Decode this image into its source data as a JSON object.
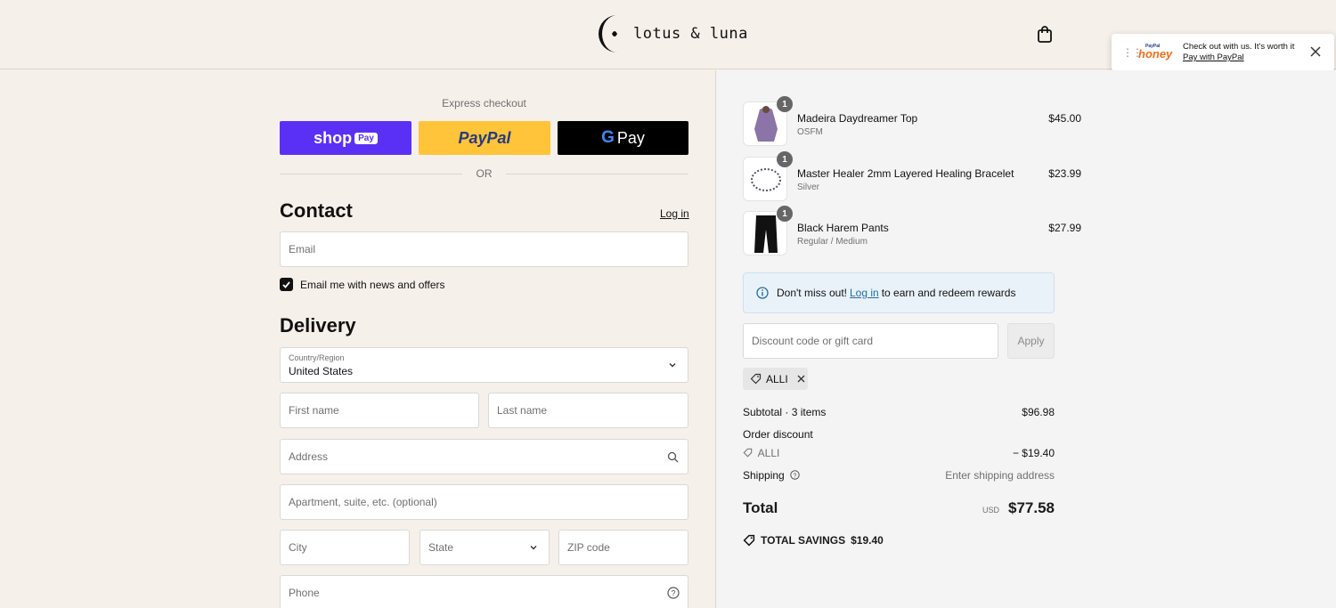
{
  "header": {
    "brand": "lotus & luna"
  },
  "honey": {
    "brand_small": "PayPal",
    "brand": "honey",
    "message": "Check out with us. It's worth it",
    "link": "Pay with PayPal"
  },
  "checkout": {
    "express_label": "Express checkout",
    "shop_pay": "shop",
    "shop_pay_badge": "Pay",
    "paypal": "PayPal",
    "gpay": "Pay",
    "or": "OR",
    "contact_title": "Contact",
    "login": "Log in",
    "email_placeholder": "Email",
    "email_opt_in": "Email me with news and offers",
    "delivery_title": "Delivery",
    "country_label": "Country/Region",
    "country_value": "United States",
    "first_name": "First name",
    "last_name": "Last name",
    "address": "Address",
    "apartment": "Apartment, suite, etc. (optional)",
    "city": "City",
    "state": "State",
    "zip": "ZIP code",
    "phone": "Phone"
  },
  "summary": {
    "items": [
      {
        "name": "Madeira Daydreamer Top",
        "variant": "OSFM",
        "price": "$45.00",
        "qty": "1"
      },
      {
        "name": "Master Healer 2mm Layered Healing Bracelet",
        "variant": "Silver",
        "price": "$23.99",
        "qty": "1"
      },
      {
        "name": "Black Harem Pants",
        "variant": "Regular / Medium",
        "price": "$27.99",
        "qty": "1"
      }
    ],
    "rewards_pre": "Don't miss out!",
    "rewards_link": "Log in",
    "rewards_post": "to earn and redeem rewards",
    "discount_placeholder": "Discount code or gift card",
    "apply": "Apply",
    "code": "ALLI",
    "subtotal_label": "Subtotal · 3 items",
    "subtotal": "$96.98",
    "order_discount": "Order discount",
    "discount_code": "ALLI",
    "discount_amount": "− $19.40",
    "shipping_label": "Shipping",
    "shipping_value": "Enter shipping address",
    "total_label": "Total",
    "currency": "USD",
    "total": "$77.58",
    "savings_label": "TOTAL SAVINGS",
    "savings": "$19.40"
  }
}
